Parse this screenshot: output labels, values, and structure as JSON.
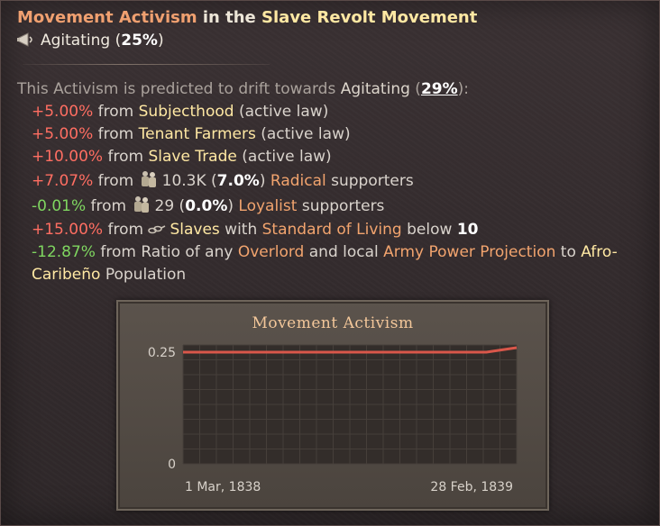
{
  "tooltip": {
    "title_part1": "Movement Activism",
    "title_part2": " in the ",
    "title_part3": "Slave Revolt Movement",
    "status_label": "Agitating",
    "status_pct_open": " (",
    "status_pct": "25%",
    "status_pct_close": ")",
    "drift_prefix": "This Activism is predicted to drift towards ",
    "drift_target": "Agitating",
    "drift_open": " (",
    "drift_pct": "29%",
    "drift_close": "):",
    "modifiers": [
      {
        "value": "+5.00%",
        "from": " from ",
        "name": "Subjecthood",
        "suffix": " (active law)"
      },
      {
        "value": "+5.00%",
        "from": " from ",
        "name": "Tenant Farmers",
        "suffix": " (active law)"
      },
      {
        "value": "+10.00%",
        "from": " from ",
        "name": "Slave Trade",
        "suffix": " (active law)"
      },
      {
        "value": "+7.07%",
        "from": " from ",
        "count": "10.3K",
        "pct_open": " (",
        "pct": "7.0%",
        "pct_close": ") ",
        "name": "Radical",
        "suffix": " supporters"
      },
      {
        "value": "-0.01%",
        "from": " from ",
        "count": "29",
        "pct_open": " (",
        "pct": "0.0%",
        "pct_close": ") ",
        "name": "Loyalist",
        "suffix": " supporters"
      },
      {
        "value": "+15.00%",
        "from": " from ",
        "name": "Slaves",
        "mid": " with ",
        "name2": "Standard of Living",
        "suffix": " below ",
        "num": "10"
      },
      {
        "value": "-12.87%",
        "text1": " from Ratio of any ",
        "name": "Overlord",
        "text2": " and local ",
        "name2": "Army Power Projection",
        "text3": " to ",
        "name3": "Afro-",
        "name3b": "Caribeño",
        "text4": " Population"
      }
    ]
  },
  "icons": {
    "status": "megaphone-icon",
    "radical": "pops-icon",
    "loyalist": "pops-icon",
    "slaves": "chains-icon"
  },
  "colors": {
    "positive": "#ff6e62",
    "negative": "#7fd660",
    "highlight": "#ffe8a3",
    "accent": "#f0a070",
    "chart_line": "#d9574a"
  },
  "chart_data": {
    "type": "line",
    "title": "Movement Activism",
    "x_labels": [
      "1 Mar, 1838",
      "28 Feb, 1839"
    ],
    "y_ticks": [
      "0.25",
      "0"
    ],
    "ylim": [
      0,
      0.25
    ],
    "series": [
      {
        "values": [
          0.25,
          0.25,
          0.25,
          0.25,
          0.25,
          0.25,
          0.25,
          0.25,
          0.25,
          0.25,
          0.25,
          0.26
        ]
      }
    ],
    "grid": true
  }
}
